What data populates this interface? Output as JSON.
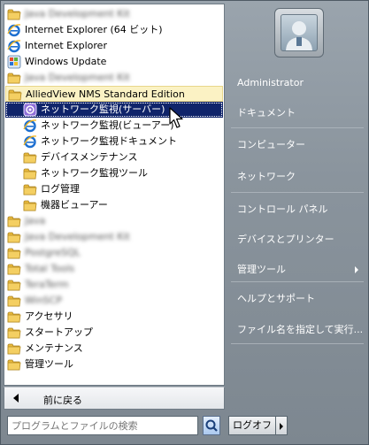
{
  "programs": [
    {
      "label": "Java Development Kit",
      "icon": "folder-icon",
      "indent": 0,
      "blurred": true
    },
    {
      "label": "Internet Explorer (64 ビット)",
      "icon": "internet-explorer-icon",
      "indent": 0
    },
    {
      "label": "Internet Explorer",
      "icon": "internet-explorer-icon",
      "indent": 0
    },
    {
      "label": "Windows Update",
      "icon": "windows-update-icon",
      "indent": 0
    },
    {
      "label": "Java Development Kit",
      "icon": "folder-icon",
      "indent": 0,
      "blurred": true
    },
    {
      "label": "AlliedView NMS Standard Edition",
      "icon": "folder-icon",
      "indent": 0,
      "state": "hover"
    },
    {
      "label": "ネットワーク監視(サーバー)",
      "icon": "network-monitor-server-icon",
      "indent": 1,
      "state": "selected"
    },
    {
      "label": "ネットワーク監視(ビューアー)",
      "icon": "internet-explorer-icon",
      "indent": 1
    },
    {
      "label": "ネットワーク監視ドキュメント",
      "icon": "internet-explorer-icon",
      "indent": 1
    },
    {
      "label": "デバイスメンテナンス",
      "icon": "folder-icon",
      "indent": 1
    },
    {
      "label": "ネットワーク監視ツール",
      "icon": "folder-icon",
      "indent": 1
    },
    {
      "label": "ログ管理",
      "icon": "folder-icon",
      "indent": 1
    },
    {
      "label": "機器ビューアー",
      "icon": "folder-icon",
      "indent": 1
    },
    {
      "label": "Java",
      "icon": "folder-icon",
      "indent": 0,
      "blurred": true
    },
    {
      "label": "Java Development Kit",
      "icon": "folder-icon",
      "indent": 0,
      "blurred": true
    },
    {
      "label": "PostgreSQL",
      "icon": "folder-icon",
      "indent": 0,
      "blurred": true
    },
    {
      "label": "Total Tools",
      "icon": "folder-icon",
      "indent": 0,
      "blurred": true
    },
    {
      "label": "TeraTerm",
      "icon": "folder-icon",
      "indent": 0,
      "blurred": true
    },
    {
      "label": "WinSCP",
      "icon": "folder-icon",
      "indent": 0,
      "blurred": true
    },
    {
      "label": "アクセサリ",
      "icon": "folder-icon",
      "indent": 0
    },
    {
      "label": "スタートアップ",
      "icon": "folder-icon",
      "indent": 0
    },
    {
      "label": "メンテナンス",
      "icon": "folder-icon",
      "indent": 0
    },
    {
      "label": "管理ツール",
      "icon": "folder-icon",
      "indent": 0
    }
  ],
  "back_label": "前に戻る",
  "user": {
    "name": "Administrator"
  },
  "right_items": [
    {
      "label": "Administrator",
      "submenu": false
    },
    {
      "label": "ドキュメント",
      "submenu": false
    },
    {
      "label": "コンピューター",
      "submenu": false
    },
    {
      "label": "ネットワーク",
      "submenu": false
    },
    {
      "label": "コントロール パネル",
      "submenu": false
    },
    {
      "label": "デバイスとプリンター",
      "submenu": false
    },
    {
      "label": "管理ツール",
      "submenu": true
    },
    {
      "label": "ヘルプとサポート",
      "submenu": false
    },
    {
      "label": "ファイル名を指定して実行...",
      "submenu": false
    }
  ],
  "search": {
    "placeholder": "プログラムとファイルの検索"
  },
  "logoff_label": "ログオフ",
  "colors": {
    "selection": "#10246a",
    "hover": "#fbf2c4",
    "folder": "#e8b93c"
  }
}
